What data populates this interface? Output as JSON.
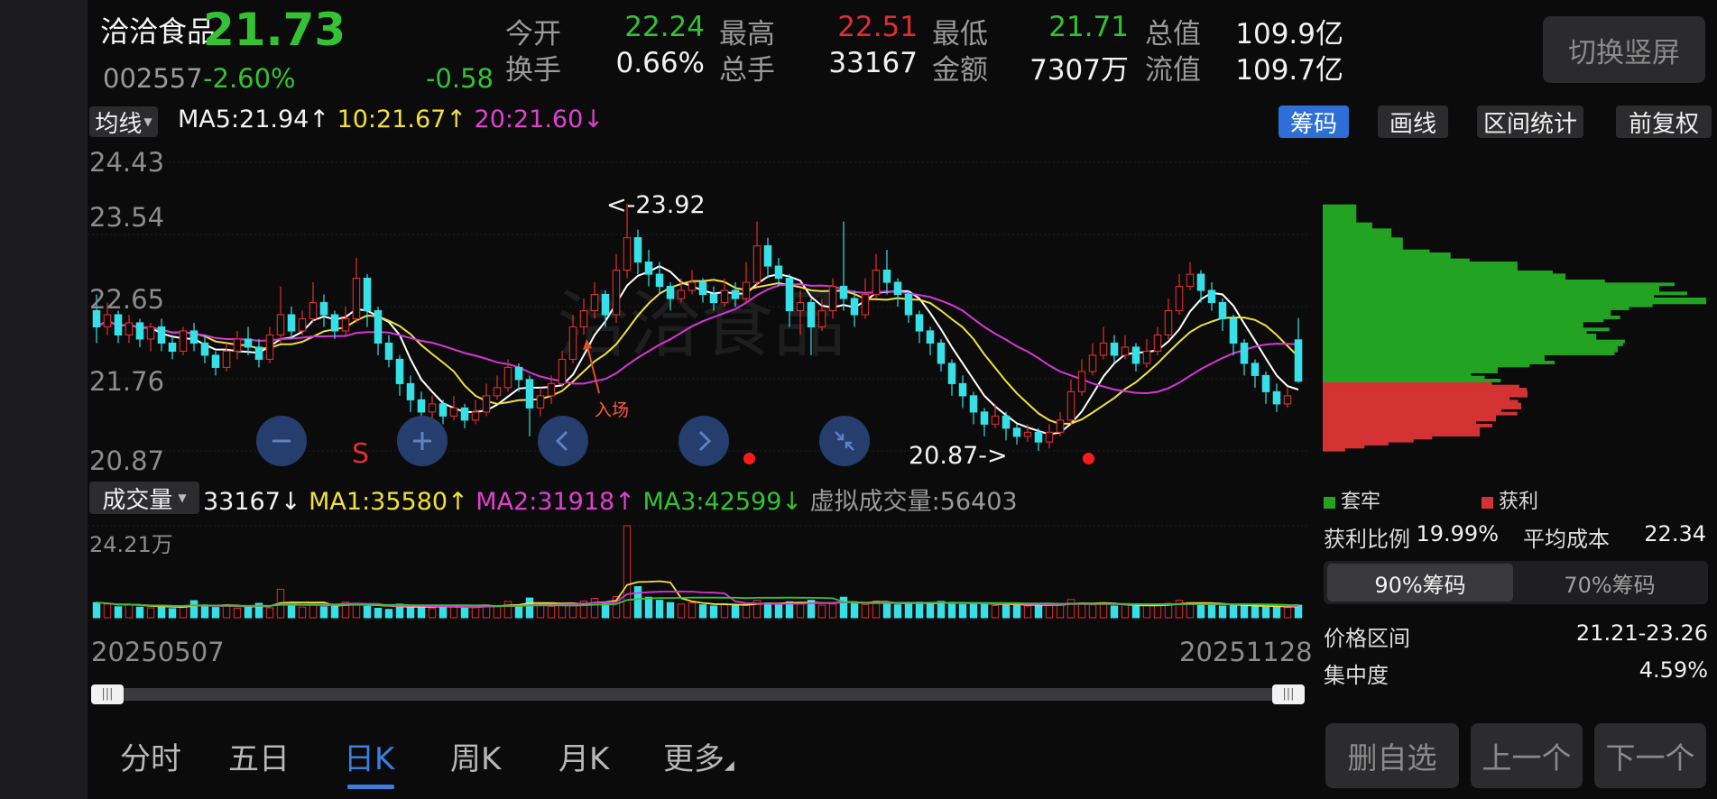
{
  "header": {
    "name": "洽洽食品",
    "price": "21.73",
    "code": "002557",
    "change_pct": "-2.60%",
    "change_amt": "-0.58",
    "switch_button": "切换竖屏",
    "stats": [
      {
        "label": "今开",
        "value": "22.24",
        "color": "#34c234"
      },
      {
        "label": "最高",
        "value": "22.51",
        "color": "#e02e2e"
      },
      {
        "label": "最低",
        "value": "21.71",
        "color": "#34c234"
      },
      {
        "label": "总值",
        "value": "109.9亿",
        "color": "#f2f2f2"
      },
      {
        "label": "换手",
        "value": "0.66%",
        "color": "#f2f2f2"
      },
      {
        "label": "总手",
        "value": "33167",
        "color": "#f2f2f2"
      },
      {
        "label": "金额",
        "value": "7307万",
        "color": "#f2f2f2"
      },
      {
        "label": "流值",
        "value": "109.7亿",
        "color": "#f2f2f2"
      }
    ]
  },
  "ma_bar": {
    "selector": "均线",
    "ma5": "MA5:21.94",
    "ma10": "10:21.67",
    "ma20": "20:21.60",
    "buttons": [
      "筹码",
      "画线",
      "区间统计",
      "前复权"
    ]
  },
  "price_axis": [
    "24.43",
    "23.54",
    "22.65",
    "21.76",
    "20.87"
  ],
  "annotations": {
    "high": "<-23.92",
    "low": "20.87->",
    "entry": "入场",
    "sell": "S",
    "watermark": "洽洽食品"
  },
  "volume_bar": {
    "selector": "成交量",
    "vol": "33167",
    "ma1": "MA1:35580",
    "ma2": "MA2:31918",
    "ma3": "MA3:42599",
    "virtual": "虚拟成交量:56403",
    "axis_max": "24.21万"
  },
  "dates": {
    "start": "20250507",
    "end": "20251128"
  },
  "period_tabs": [
    "分时",
    "五日",
    "日K",
    "周K",
    "月K",
    "更多"
  ],
  "active_tab": "日K",
  "chips_panel": {
    "legend": [
      {
        "label": "套牢",
        "color": "#22a322"
      },
      {
        "label": "获利",
        "color": "#d33333"
      }
    ],
    "profit_ratio_label": "获利比例",
    "profit_ratio": "19.99%",
    "avg_cost_label": "平均成本",
    "avg_cost": "22.34",
    "tabs": [
      "90%筹码",
      "70%筹码"
    ],
    "price_range_label": "价格区间",
    "price_range": "21.21-23.26",
    "concentration_label": "集中度",
    "concentration": "4.59%"
  },
  "bottom_buttons": [
    "删自选",
    "上一个",
    "下一个"
  ],
  "colors": {
    "up": "#e02e2e",
    "down": "#36e0e6",
    "ma5": "#ffffff",
    "ma10": "#f0e040",
    "ma20": "#d935d9",
    "accent": "#2d6fd6"
  },
  "chart_data": {
    "type": "candlestick",
    "price_range": [
      20.87,
      24.43
    ],
    "candles": [
      [
        22.6,
        22.4,
        22.8,
        22.2
      ],
      [
        22.4,
        22.55,
        22.7,
        22.3
      ],
      [
        22.55,
        22.3,
        22.6,
        22.2
      ],
      [
        22.3,
        22.45,
        22.55,
        22.2
      ],
      [
        22.45,
        22.25,
        22.5,
        22.15
      ],
      [
        22.25,
        22.4,
        22.45,
        22.1
      ],
      [
        22.4,
        22.2,
        22.5,
        22.1
      ],
      [
        22.2,
        22.1,
        22.3,
        22.0
      ],
      [
        22.1,
        22.35,
        22.4,
        22.05
      ],
      [
        22.35,
        22.2,
        22.45,
        22.1
      ],
      [
        22.2,
        22.05,
        22.3,
        21.95
      ],
      [
        22.05,
        21.9,
        22.1,
        21.8
      ],
      [
        21.9,
        22.1,
        22.2,
        21.85
      ],
      [
        22.1,
        22.25,
        22.35,
        22.0
      ],
      [
        22.25,
        22.15,
        22.4,
        22.05
      ],
      [
        22.15,
        22.0,
        22.25,
        21.9
      ],
      [
        22.0,
        22.3,
        22.4,
        21.95
      ],
      [
        22.3,
        22.55,
        22.9,
        22.2
      ],
      [
        22.55,
        22.35,
        22.65,
        22.25
      ],
      [
        22.35,
        22.5,
        22.6,
        22.3
      ],
      [
        22.5,
        22.7,
        22.95,
        22.45
      ],
      [
        22.7,
        22.55,
        22.8,
        22.4
      ],
      [
        22.55,
        22.35,
        22.6,
        22.25
      ],
      [
        22.35,
        22.5,
        22.65,
        22.3
      ],
      [
        22.5,
        23.0,
        23.25,
        22.45
      ],
      [
        23.0,
        22.6,
        23.05,
        22.4
      ],
      [
        22.6,
        22.2,
        22.65,
        22.05
      ],
      [
        22.2,
        22.0,
        22.3,
        21.9
      ],
      [
        22.0,
        21.7,
        22.05,
        21.55
      ],
      [
        21.7,
        21.5,
        21.8,
        21.35
      ],
      [
        21.5,
        21.35,
        21.6,
        21.15
      ],
      [
        21.35,
        21.45,
        21.55,
        21.25
      ],
      [
        21.45,
        21.3,
        21.5,
        21.2
      ],
      [
        21.3,
        21.4,
        21.55,
        21.25
      ],
      [
        21.4,
        21.25,
        21.45,
        21.15
      ],
      [
        21.25,
        21.35,
        21.5,
        21.2
      ],
      [
        21.35,
        21.55,
        21.7,
        21.3
      ],
      [
        21.55,
        21.65,
        21.8,
        21.5
      ],
      [
        21.65,
        21.9,
        22.0,
        21.6
      ],
      [
        21.9,
        21.75,
        21.95,
        21.6
      ],
      [
        21.75,
        21.4,
        21.8,
        21.05
      ],
      [
        21.4,
        21.55,
        21.65,
        21.3
      ],
      [
        21.55,
        21.7,
        21.8,
        21.45
      ],
      [
        21.7,
        22.0,
        22.1,
        21.65
      ],
      [
        22.0,
        22.4,
        22.55,
        21.95
      ],
      [
        22.4,
        22.6,
        22.75,
        22.3
      ],
      [
        22.6,
        22.8,
        22.95,
        22.5
      ],
      [
        22.8,
        22.55,
        22.85,
        22.4
      ],
      [
        22.55,
        23.1,
        23.3,
        22.45
      ],
      [
        23.1,
        23.5,
        23.92,
        23.0
      ],
      [
        23.5,
        23.2,
        23.6,
        23.05
      ],
      [
        23.2,
        23.05,
        23.35,
        22.9
      ],
      [
        23.05,
        22.9,
        23.2,
        22.8
      ],
      [
        22.9,
        22.75,
        22.95,
        22.6
      ],
      [
        22.75,
        22.85,
        23.0,
        22.7
      ],
      [
        22.85,
        22.95,
        23.1,
        22.8
      ],
      [
        22.95,
        22.8,
        23.0,
        22.7
      ],
      [
        22.8,
        22.7,
        22.9,
        22.6
      ],
      [
        22.7,
        22.85,
        23.0,
        22.65
      ],
      [
        22.85,
        22.75,
        22.95,
        22.65
      ],
      [
        22.75,
        22.95,
        23.2,
        22.7
      ],
      [
        22.95,
        23.4,
        23.7,
        22.9
      ],
      [
        23.4,
        23.15,
        23.5,
        23.0
      ],
      [
        23.15,
        23.0,
        23.25,
        22.9
      ],
      [
        23.0,
        22.6,
        23.05,
        22.4
      ],
      [
        22.6,
        22.7,
        22.85,
        22.3
      ],
      [
        22.7,
        22.4,
        22.75,
        22.05
      ],
      [
        22.4,
        22.6,
        22.75,
        22.35
      ],
      [
        22.6,
        22.9,
        23.0,
        22.5
      ],
      [
        22.9,
        22.75,
        23.7,
        22.6
      ],
      [
        22.75,
        22.55,
        22.85,
        22.4
      ],
      [
        22.55,
        22.8,
        23.0,
        22.5
      ],
      [
        22.8,
        23.1,
        23.3,
        22.75
      ],
      [
        23.1,
        22.95,
        23.35,
        22.8
      ],
      [
        22.95,
        22.8,
        23.0,
        22.65
      ],
      [
        22.8,
        22.55,
        22.85,
        22.45
      ],
      [
        22.55,
        22.35,
        22.6,
        22.2
      ],
      [
        22.35,
        22.2,
        22.4,
        22.05
      ],
      [
        22.2,
        21.95,
        22.25,
        21.85
      ],
      [
        21.95,
        21.7,
        22.0,
        21.55
      ],
      [
        21.7,
        21.55,
        21.8,
        21.4
      ],
      [
        21.55,
        21.35,
        21.6,
        21.2
      ],
      [
        21.35,
        21.2,
        21.4,
        21.05
      ],
      [
        21.2,
        21.3,
        21.45,
        21.15
      ],
      [
        21.3,
        21.15,
        21.35,
        21.0
      ],
      [
        21.15,
        21.05,
        21.2,
        20.95
      ],
      [
        21.05,
        21.1,
        21.2,
        20.98
      ],
      [
        21.1,
        20.98,
        21.15,
        20.87
      ],
      [
        20.98,
        21.1,
        21.2,
        20.9
      ],
      [
        21.1,
        21.25,
        21.35,
        21.05
      ],
      [
        21.25,
        21.6,
        21.75,
        21.2
      ],
      [
        21.6,
        21.85,
        22.0,
        21.55
      ],
      [
        21.85,
        22.05,
        22.2,
        21.8
      ],
      [
        22.05,
        22.2,
        22.4,
        22.0
      ],
      [
        22.2,
        22.05,
        22.3,
        21.95
      ],
      [
        22.05,
        22.15,
        22.3,
        22.0
      ],
      [
        22.15,
        21.95,
        22.2,
        21.85
      ],
      [
        21.95,
        22.1,
        22.25,
        21.9
      ],
      [
        22.1,
        22.3,
        22.4,
        22.05
      ],
      [
        22.3,
        22.6,
        22.75,
        22.25
      ],
      [
        22.6,
        22.9,
        23.05,
        22.55
      ],
      [
        22.9,
        23.05,
        23.2,
        22.85
      ],
      [
        23.05,
        22.85,
        23.1,
        22.7
      ],
      [
        22.85,
        22.7,
        22.95,
        22.6
      ],
      [
        22.7,
        22.5,
        22.75,
        22.35
      ],
      [
        22.5,
        22.2,
        22.55,
        22.05
      ],
      [
        22.2,
        21.95,
        22.25,
        21.8
      ],
      [
        21.95,
        21.8,
        22.0,
        21.65
      ],
      [
        21.8,
        21.6,
        21.85,
        21.45
      ],
      [
        21.6,
        21.45,
        21.7,
        21.35
      ],
      [
        21.45,
        21.55,
        21.65,
        21.4
      ],
      [
        22.24,
        21.73,
        22.51,
        21.71
      ]
    ],
    "volumes": [
      4.0,
      3.6,
      2.9,
      3.5,
      2.8,
      2.6,
      3.2,
      2.4,
      3.0,
      4.5,
      3.3,
      2.7,
      3.1,
      2.5,
      2.9,
      3.8,
      2.6,
      7.5,
      3.4,
      2.8,
      3.6,
      2.9,
      3.2,
      4.1,
      3.7,
      3.0,
      2.5,
      2.2,
      3.6,
      2.9,
      3.1,
      2.4,
      2.7,
      3.3,
      2.6,
      2.9,
      3.4,
      3.1,
      4.3,
      3.2,
      5.2,
      3.6,
      3.0,
      3.8,
      3.5,
      4.4,
      5.1,
      3.9,
      5.6,
      24.21,
      8.2,
      5.4,
      4.6,
      4.0,
      3.6,
      3.9,
      3.4,
      3.1,
      3.7,
      3.2,
      3.5,
      4.6,
      3.9,
      3.5,
      4.2,
      3.8,
      4.6,
      3.3,
      3.6,
      5.4,
      3.9,
      3.5,
      4.4,
      3.8,
      3.4,
      3.9,
      4.1,
      3.6,
      4.3,
      3.9,
      3.5,
      3.8,
      3.6,
      3.2,
      3.7,
      3.4,
      3.1,
      3.5,
      3.2,
      3.6,
      4.8,
      3.9,
      3.4,
      3.6,
      3.1,
      3.4,
      3.0,
      3.2,
      3.5,
      3.8,
      4.6,
      4.0,
      3.5,
      3.3,
      3.1,
      3.4,
      3.2,
      2.9,
      2.8,
      3.0,
      2.7,
      3.32
    ],
    "volume_max": 24.21,
    "chip_distribution_range": [
      20.87,
      24.43
    ],
    "chip_profit_ratio": 19.99,
    "avg_cost": 22.34
  }
}
